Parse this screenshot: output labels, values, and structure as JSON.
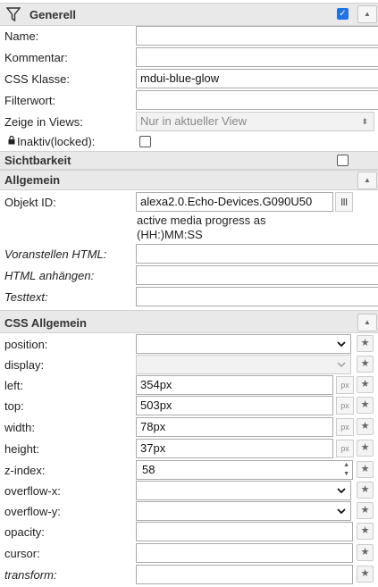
{
  "generell": {
    "title": "Generell",
    "checked": true,
    "fields": {
      "name_label": "Name:",
      "name_value": "",
      "kommentar_label": "Kommentar:",
      "kommentar_value": "",
      "css_klasse_label": "CSS Klasse:",
      "css_klasse_value": "mdui-blue-glow",
      "filterwort_label": "Filterwort:",
      "filterwort_value": "",
      "views_label": "Zeige in Views:",
      "views_value": "Nur in aktueller View",
      "inaktiv_label": "Inaktiv(locked):",
      "inaktiv_checked": false
    }
  },
  "sichtbarkeit": {
    "title": "Sichtbarkeit",
    "checked": false
  },
  "allgemein": {
    "title": "Allgemein",
    "objekt_label": "Objekt ID:",
    "objekt_value": "alexa2.0.Echo-Devices.G090U50",
    "objekt_note_1": "active media progress as",
    "objekt_note_2": "(HH:)MM:SS",
    "voranstellen_label": "Voranstellen HTML:",
    "voranstellen_value": "",
    "anhaengen_label": "HTML anhängen:",
    "anhaengen_value": "",
    "testtext_label": "Testtext:",
    "testtext_value": ""
  },
  "css_allgemein": {
    "title": "CSS Allgemein",
    "position_label": "position:",
    "position_value": "",
    "display_label": "display:",
    "display_value": "",
    "left_label": "left:",
    "left_value": "354px",
    "top_label": "top:",
    "top_value": "503px",
    "width_label": "width:",
    "width_value": "78px",
    "height_label": "height:",
    "height_value": "37px",
    "unit": "px",
    "zindex_label": "z-index:",
    "zindex_value": "58",
    "overflowx_label": "overflow-x:",
    "overflowx_value": "",
    "overflowy_label": "overflow-y:",
    "overflowy_value": "",
    "opacity_label": "opacity:",
    "opacity_value": "",
    "cursor_label": "cursor:",
    "cursor_value": "",
    "transform_label": "transform:",
    "transform_value": ""
  },
  "icons": {
    "filter": "filter-icon",
    "collapse": "chevron-up-icon",
    "lock": "lock-icon",
    "star": "star-icon",
    "select_arrow": "chevron-down-icon",
    "list": "list-icon"
  },
  "colors": {
    "accent": "#1e73e8",
    "header_bg": "#e9e9e9"
  }
}
